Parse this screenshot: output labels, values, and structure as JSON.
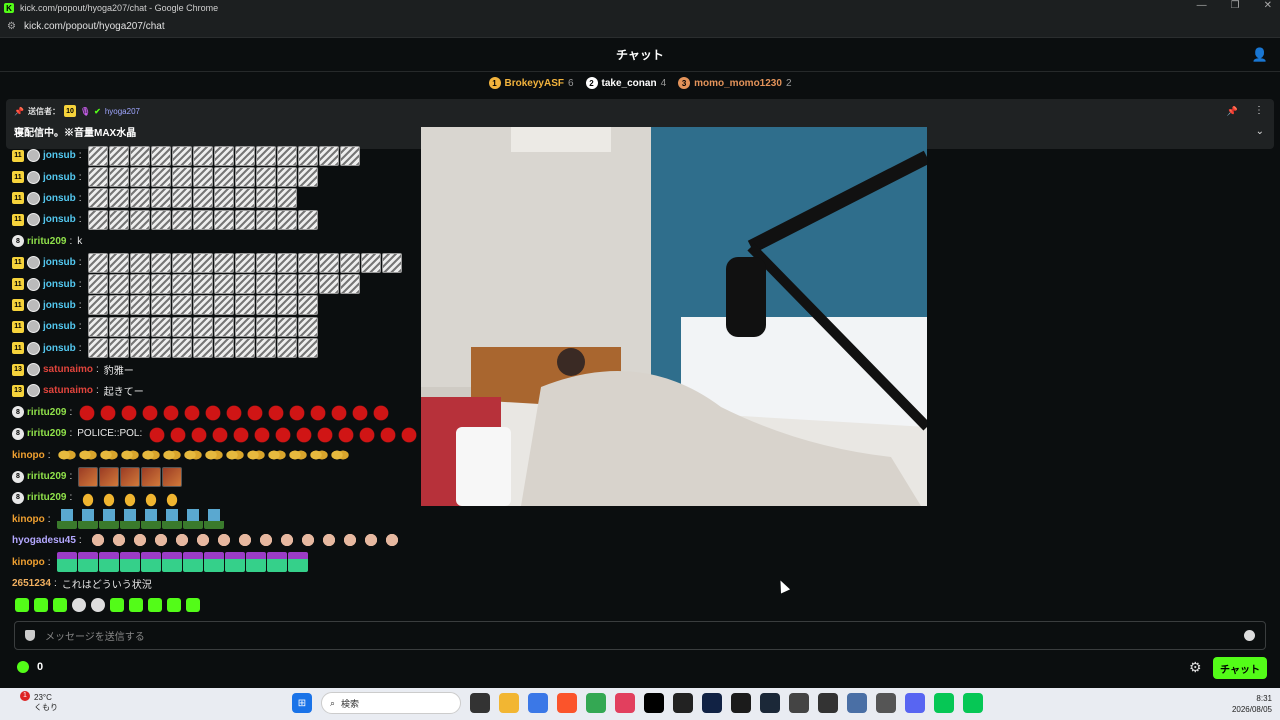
{
  "window": {
    "title": "kick.com/popout/hyoga207/chat - Google Chrome",
    "url": "kick.com/popout/hyoga207/chat"
  },
  "header": {
    "title": "チャット"
  },
  "leaderboard": [
    {
      "rank": "1",
      "name": "BrokeyyASF",
      "count": "6",
      "color": "#f2b33d"
    },
    {
      "rank": "2",
      "name": "take_conan",
      "count": "4",
      "color": "#ffffff"
    },
    {
      "rank": "3",
      "name": "momo_momo1230",
      "count": "2",
      "color": "#e3935a"
    }
  ],
  "pinned": {
    "label": "送信者：",
    "sub_months": "10",
    "author": "hyoga207",
    "text": "寝配信中。※音量MAX水晶"
  },
  "messages": [
    {
      "badge": "11",
      "badge_type": "sub",
      "user": "jonsub",
      "color": "#53c8f0",
      "text": "",
      "emote": "face",
      "emote_count": 13
    },
    {
      "badge": "11",
      "badge_type": "sub",
      "user": "jonsub",
      "color": "#53c8f0",
      "text": "",
      "emote": "face",
      "emote_count": 11
    },
    {
      "badge": "11",
      "badge_type": "sub",
      "user": "jonsub",
      "color": "#53c8f0",
      "text": "",
      "emote": "face",
      "emote_count": 10
    },
    {
      "badge": "11",
      "badge_type": "sub",
      "user": "jonsub",
      "color": "#53c8f0",
      "text": "",
      "emote": "face",
      "emote_count": 11
    },
    {
      "badge": "8",
      "badge_type": "circle",
      "user": "riritu209",
      "color": "#8fe04a",
      "text": "k",
      "emote": "",
      "emote_count": 0
    },
    {
      "badge": "11",
      "badge_type": "sub",
      "user": "jonsub",
      "color": "#53c8f0",
      "text": "",
      "emote": "face",
      "emote_count": 15
    },
    {
      "badge": "11",
      "badge_type": "sub",
      "user": "jonsub",
      "color": "#53c8f0",
      "text": "",
      "emote": "face",
      "emote_count": 13
    },
    {
      "badge": "11",
      "badge_type": "sub",
      "user": "jonsub",
      "color": "#53c8f0",
      "text": "",
      "emote": "face",
      "emote_count": 11
    },
    {
      "badge": "11",
      "badge_type": "sub",
      "user": "jonsub",
      "color": "#53c8f0",
      "text": "",
      "emote": "face",
      "emote_count": 11
    },
    {
      "badge": "11",
      "badge_type": "sub",
      "user": "jonsub",
      "color": "#53c8f0",
      "text": "",
      "emote": "face",
      "emote_count": 11
    },
    {
      "badge": "13",
      "badge_type": "sub",
      "user": "satunaimo",
      "color": "#e0443c",
      "text": "豹雅ー",
      "emote": "",
      "emote_count": 0
    },
    {
      "badge": "13",
      "badge_type": "sub",
      "user": "satunaimo",
      "color": "#e0443c",
      "text": "起きてー",
      "emote": "",
      "emote_count": 0
    },
    {
      "badge": "8",
      "badge_type": "circle",
      "user": "riritu209",
      "color": "#8fe04a",
      "text": "",
      "emote": "apple",
      "emote_count": 15
    },
    {
      "badge": "8",
      "badge_type": "circle",
      "user": "riritu209",
      "color": "#8fe04a",
      "text": "POLICE::POL:",
      "emote": "apple",
      "emote_count": 13
    },
    {
      "badge": "",
      "badge_type": "none",
      "user": "kinopo",
      "color": "#f0a030",
      "text": "",
      "emote": "butter",
      "emote_count": 14
    },
    {
      "badge": "8",
      "badge_type": "circle",
      "user": "riritu209",
      "color": "#8fe04a",
      "text": "",
      "emote": "brick",
      "emote_count": 5
    },
    {
      "badge": "8",
      "badge_type": "circle",
      "user": "riritu209",
      "color": "#8fe04a",
      "text": "",
      "emote": "finger",
      "emote_count": 5
    },
    {
      "badge": "",
      "badge_type": "none",
      "user": "kinopo",
      "color": "#f0a030",
      "text": "",
      "emote": "croc",
      "emote_count": 8
    },
    {
      "badge": "",
      "badge_type": "none",
      "user": "hyogadesu45",
      "color": "#b4a8ff",
      "text": "",
      "emote": "bald",
      "emote_count": 15
    },
    {
      "badge": "",
      "badge_type": "none",
      "user": "kinopo",
      "color": "#f0a030",
      "text": "",
      "emote": "kick",
      "emote_count": 12
    },
    {
      "badge": "",
      "badge_type": "none",
      "user": "2651234",
      "color": "#f0b060",
      "text": "これはどういう状況",
      "emote": "",
      "emote_count": 0
    }
  ],
  "input": {
    "placeholder": "メッセージを送信する"
  },
  "kick_points": "0",
  "chat_button": "チャット",
  "taskbar": {
    "temp": "23°C",
    "weather": "くもり",
    "search": "検索",
    "time": "8:31",
    "date": "2026/08/05",
    "weather_badge": "1"
  }
}
